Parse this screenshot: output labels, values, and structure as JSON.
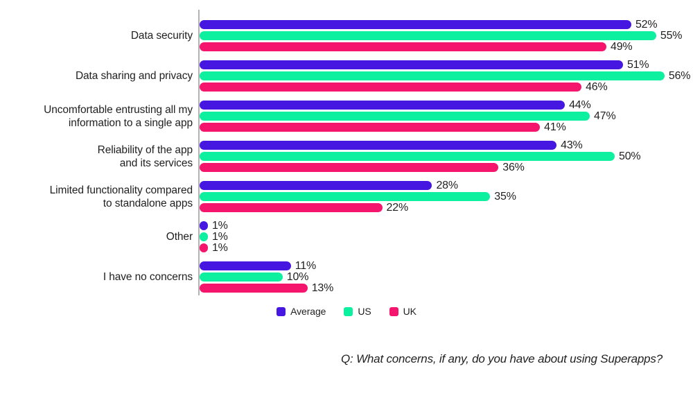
{
  "chart_data": {
    "type": "bar",
    "orientation": "horizontal",
    "title": "",
    "subtitle": "",
    "xlabel": "",
    "ylabel": "",
    "xlim": [
      0,
      60
    ],
    "grid": false,
    "legend_position": "bottom-center",
    "value_suffix": "%",
    "categories": [
      "Data security",
      "Data sharing and privacy",
      "Uncomfortable entrusting all my\ninformation to a single app",
      "Reliability of the app\nand its services",
      "Limited functionality compared\nto standalone apps",
      "Other",
      "I have no concerns"
    ],
    "series": [
      {
        "name": "Average",
        "color": "#4617E0",
        "values": [
          52,
          51,
          44,
          43,
          28,
          1,
          11
        ],
        "labels": [
          "52%",
          "51%",
          "44%",
          "43%",
          "28%",
          "1%",
          "11%"
        ]
      },
      {
        "name": "US",
        "color": "#0CF0A0",
        "values": [
          55,
          56,
          47,
          50,
          35,
          1,
          10
        ],
        "labels": [
          "55%",
          "56%",
          "47%",
          "50%",
          "35%",
          "1%",
          "10%"
        ]
      },
      {
        "name": "UK",
        "color": "#F5156C",
        "values": [
          49,
          46,
          41,
          36,
          22,
          1,
          13
        ],
        "labels": [
          "49%",
          "46%",
          "41%",
          "36%",
          "22%",
          "1%",
          "13%"
        ]
      }
    ],
    "annotation": "Q: What concerns, if any, do you have about using Superapps?"
  },
  "legend": {
    "items": [
      {
        "label": "Average",
        "color": "#4617E0"
      },
      {
        "label": "US",
        "color": "#0CF0A0"
      },
      {
        "label": "UK",
        "color": "#F5156C"
      }
    ]
  },
  "footnote": {
    "text": "Q: What concerns, if any, do you have about using Superapps?"
  },
  "axis": {
    "line_color": "#b3b3b3"
  }
}
